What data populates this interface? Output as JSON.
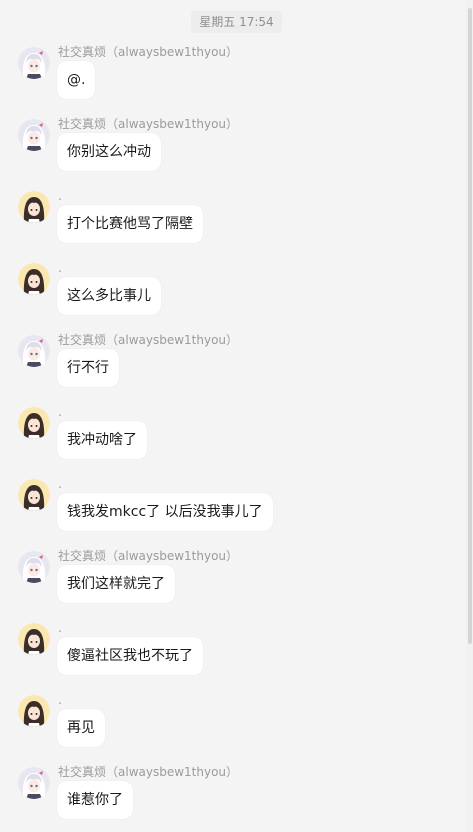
{
  "timestamp": "星期五 17:54",
  "contacts": {
    "a": {
      "name": "社交真烦（alwaysbew1thyou）",
      "avatar_icon": "anime-girl-white-hair-avatar-icon"
    },
    "b": {
      "name": ".",
      "avatar_icon": "anime-girl-dark-hair-avatar-icon"
    }
  },
  "messages": [
    {
      "sender": "社交真烦（alwaysbew1thyou）",
      "text": "@."
    },
    {
      "sender": "社交真烦（alwaysbew1thyou）",
      "text": "你别这么冲动"
    },
    {
      "sender": ".",
      "text": "打个比赛他骂了隔壁"
    },
    {
      "sender": ".",
      "text": "这么多比事儿"
    },
    {
      "sender": "社交真烦（alwaysbew1thyou）",
      "text": "行不行"
    },
    {
      "sender": ".",
      "text": "我冲动啥了"
    },
    {
      "sender": ".",
      "text": "钱我发mkcc了 以后没我事儿了"
    },
    {
      "sender": "社交真烦（alwaysbew1thyou）",
      "text": "我们这样就完了"
    },
    {
      "sender": ".",
      "text": "傻逼社区我也不玩了"
    },
    {
      "sender": ".",
      "text": "再见"
    },
    {
      "sender": "社交真烦（alwaysbew1thyou）",
      "text": "谁惹你了"
    }
  ],
  "colors": {
    "background": "#f4f4f4",
    "bubble": "#ffffff",
    "sender_text": "#9a9a9a"
  }
}
